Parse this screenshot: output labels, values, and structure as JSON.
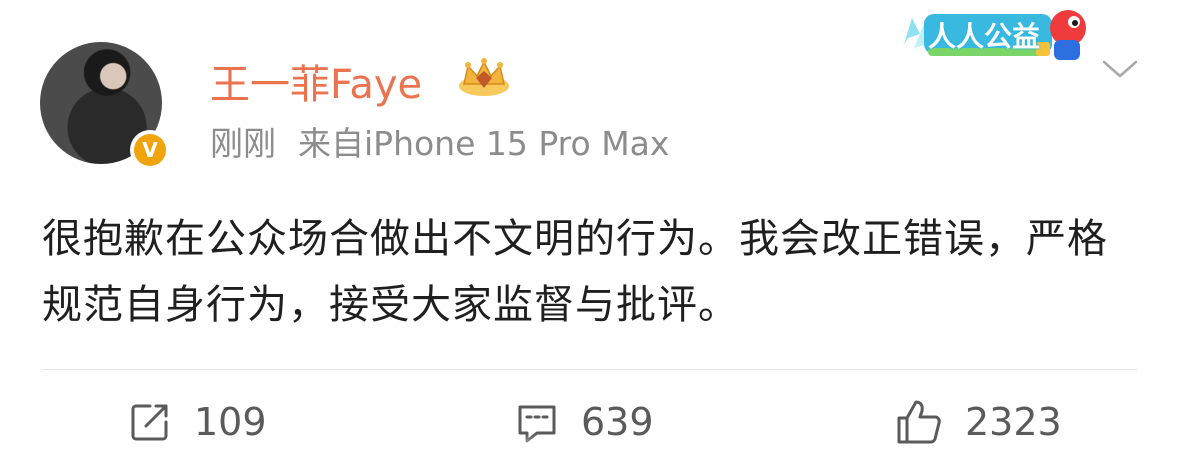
{
  "author": {
    "name": "王一菲Faye",
    "verified_mark": "V"
  },
  "post": {
    "time": "刚刚",
    "source": "来自iPhone 15 Pro Max",
    "text": "很抱歉在公众场合做出不文明的行为。我会改正错误，严格规范自身行为，接受大家监督与批评。"
  },
  "banner": {
    "label": "人人公益"
  },
  "actions": {
    "reposts": "109",
    "comments": "639",
    "likes": "2323"
  },
  "colors": {
    "username": "#eb7350",
    "meta": "#8c8c8c",
    "verified": "#f0a30a",
    "action": "#5a5a5a"
  },
  "icons": [
    "avatar-image",
    "verified-badge-icon",
    "crown-icon",
    "charity-badge",
    "chevron-down-icon",
    "repost-icon",
    "comment-icon",
    "like-icon"
  ]
}
